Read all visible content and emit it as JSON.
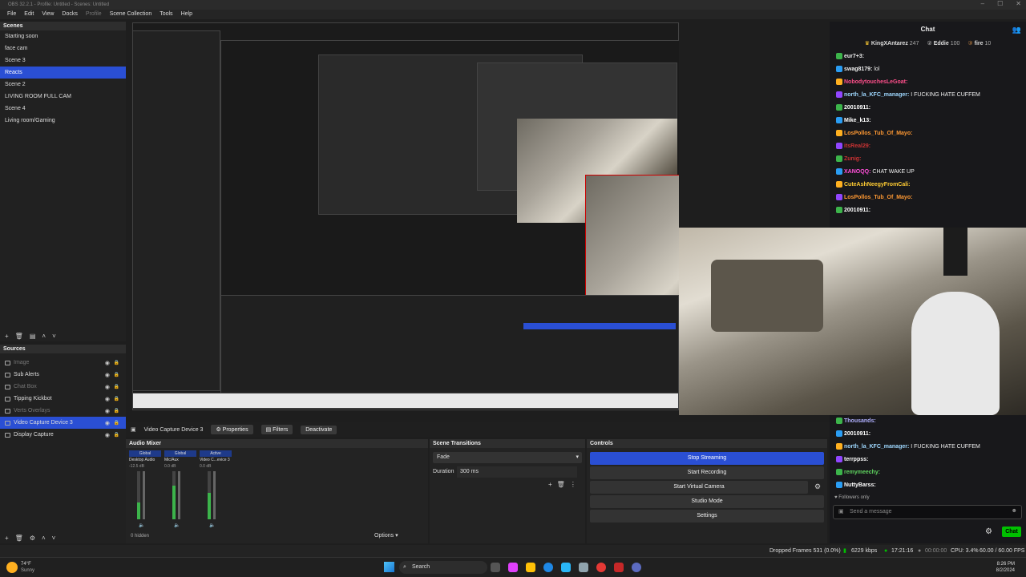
{
  "window": {
    "title": "OBS 32.2.1 - Profile: Untitled - Scenes: Untitled"
  },
  "menu": [
    "File",
    "Edit",
    "View",
    "Docks",
    "Profile",
    "Scene Collection",
    "Tools",
    "Help"
  ],
  "scenes": {
    "header": "Scenes",
    "items": [
      "Starting soon",
      "face cam",
      "Scene 3",
      "Reacts",
      "Scene 2",
      "LIVING ROOM FULL CAM",
      "Scene 4",
      "Living room/Gaming"
    ],
    "selected": "Reacts"
  },
  "sources": {
    "header": "Sources",
    "items": [
      "Image",
      "Sub Alerts",
      "Chat Box",
      "Tipping Kickbot",
      "Verts Overlays",
      "Video Capture Device 3",
      "Display Capture"
    ],
    "selected": "Video Capture Device 3"
  },
  "source_toolbar": {
    "name": "Video Capture Device 3",
    "properties": "Properties",
    "filters": "Filters",
    "deactivate": "Deactivate"
  },
  "mixer": {
    "header": "Audio Mixer",
    "channels": [
      {
        "tag": "Global",
        "name": "Desktop Audio",
        "db": "-12.5 dB",
        "level": 0.35
      },
      {
        "tag": "Global",
        "name": "Mic/Aux",
        "db": "0.0 dB",
        "level": 0.7
      },
      {
        "tag": "Active",
        "name": "Video C...evice 3",
        "db": "0.0 dB",
        "level": 0.55
      }
    ],
    "hidden": "0 hidden",
    "options": "Options"
  },
  "transitions": {
    "header": "Scene Transitions",
    "type": "Fade",
    "duration_label": "Duration",
    "duration": "300 ms"
  },
  "controls": {
    "header": "Controls",
    "buttons": [
      "Stop Streaming",
      "Start Recording",
      "Start Virtual Camera",
      "Studio Mode",
      "Settings"
    ]
  },
  "chat": {
    "header": "Chat",
    "top_badges": [
      {
        "name": "KingXAntarez",
        "count": "247"
      },
      {
        "name": "Eddie",
        "count": "100"
      },
      {
        "name": "fire",
        "count": "10"
      }
    ],
    "messages": [
      {
        "user": "eur7+3:",
        "text": "",
        "color": "#eeeeee"
      },
      {
        "user": "swag8179:",
        "text": "lol",
        "color": "#eeeeee"
      },
      {
        "user": "NobodytouchesLeGoat:",
        "text": "",
        "color": "#ff4f8b"
      },
      {
        "user": "north_la_KFC_manager:",
        "text": "I FUCKING HATE CUFFEM",
        "color": "#9fd8ff"
      },
      {
        "user": "20010911:",
        "text": "",
        "color": "#ffffff"
      },
      {
        "user": "Mike_k13:",
        "text": "",
        "color": "#ffffff"
      },
      {
        "user": "LosPollos_Tub_Of_Mayo:",
        "text": "",
        "color": "#ff9933"
      },
      {
        "user": "itsReal29:",
        "text": "",
        "color": "#cc3333"
      },
      {
        "user": "Zunig:",
        "text": "",
        "color": "#cc3333"
      },
      {
        "user": "XANOQQ:",
        "text": "CHAT WAKE UP",
        "color": "#ff4fd8"
      },
      {
        "user": "CuteAshNeegyFromCali:",
        "text": "",
        "color": "#ffcc33"
      },
      {
        "user": "LosPollos_Tub_Of_Mayo:",
        "text": "",
        "color": "#ff9933"
      },
      {
        "user": "20010911:",
        "text": "",
        "color": "#ffffff"
      }
    ],
    "messages2": [
      {
        "user": "Thousands:",
        "text": "",
        "color": "#b0b0ff"
      },
      {
        "user": "20010911:",
        "text": "",
        "color": "#ffffff"
      },
      {
        "user": "north_la_KFC_manager:",
        "text": "I FUCKING HATE CUFFEM",
        "color": "#9fd8ff"
      },
      {
        "user": "terrppss:",
        "text": "",
        "color": "#ffffff"
      },
      {
        "user": "remymeechy:",
        "text": "",
        "color": "#5fd35f"
      },
      {
        "user": "NuttyBarss:",
        "text": "",
        "color": "#ffffff"
      }
    ],
    "followers_only": "Followers only",
    "input_placeholder": "Send a message",
    "send": "Chat"
  },
  "status": {
    "dropped": "Dropped Frames 531 (0.0%)",
    "kbps": "6229 kbps",
    "live": "17:21:16",
    "rec": "00:00:00",
    "cpu": "CPU: 3.4%",
    "fps": "60.00 / 60.00 FPS"
  },
  "taskbar": {
    "weather_temp": "74°F",
    "weather_desc": "Sunny",
    "search": "Search",
    "time": "8:26 PM",
    "date": "8/2/2024"
  },
  "colors": {
    "accent": "#2a4fd4",
    "live_green": "#00c000"
  }
}
